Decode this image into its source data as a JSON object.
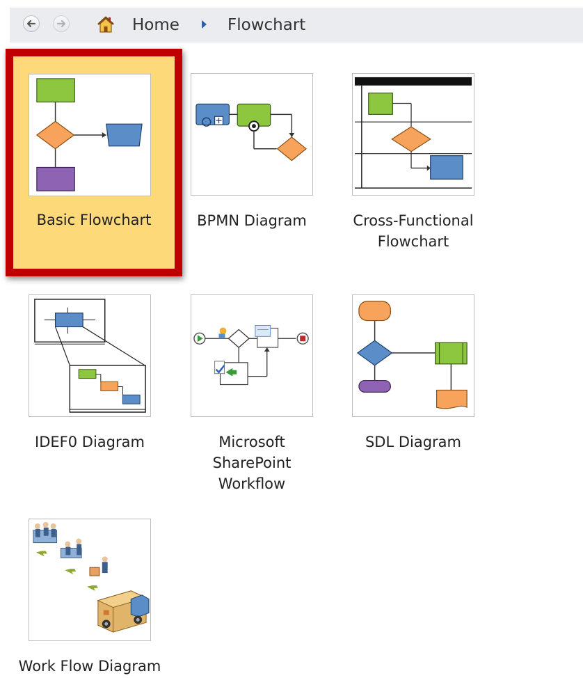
{
  "breadcrumb": {
    "back_icon": "back-arrow-icon",
    "forward_icon": "forward-arrow-icon",
    "home_icon": "home-icon",
    "home_label": "Home",
    "separator_icon": "chevron-right-icon",
    "current_label": "Flowchart"
  },
  "templates": [
    {
      "label": "Basic Flowchart",
      "selected": true
    },
    {
      "label": "BPMN Diagram",
      "selected": false
    },
    {
      "label": "Cross-Functional\nFlowchart",
      "selected": false
    },
    {
      "label": "IDEF0 Diagram",
      "selected": false
    },
    {
      "label": "Microsoft\nSharePoint\nWorkflow",
      "selected": false
    },
    {
      "label": "SDL Diagram",
      "selected": false
    },
    {
      "label": "Work Flow Diagram",
      "selected": false
    }
  ],
  "colors": {
    "selection_fill": "#fdd97a",
    "selection_border": "#c00000",
    "shape_green": "#8dc63f",
    "shape_orange": "#f7a35c",
    "shape_blue": "#5b8ec9",
    "shape_purple": "#8e63b3"
  }
}
